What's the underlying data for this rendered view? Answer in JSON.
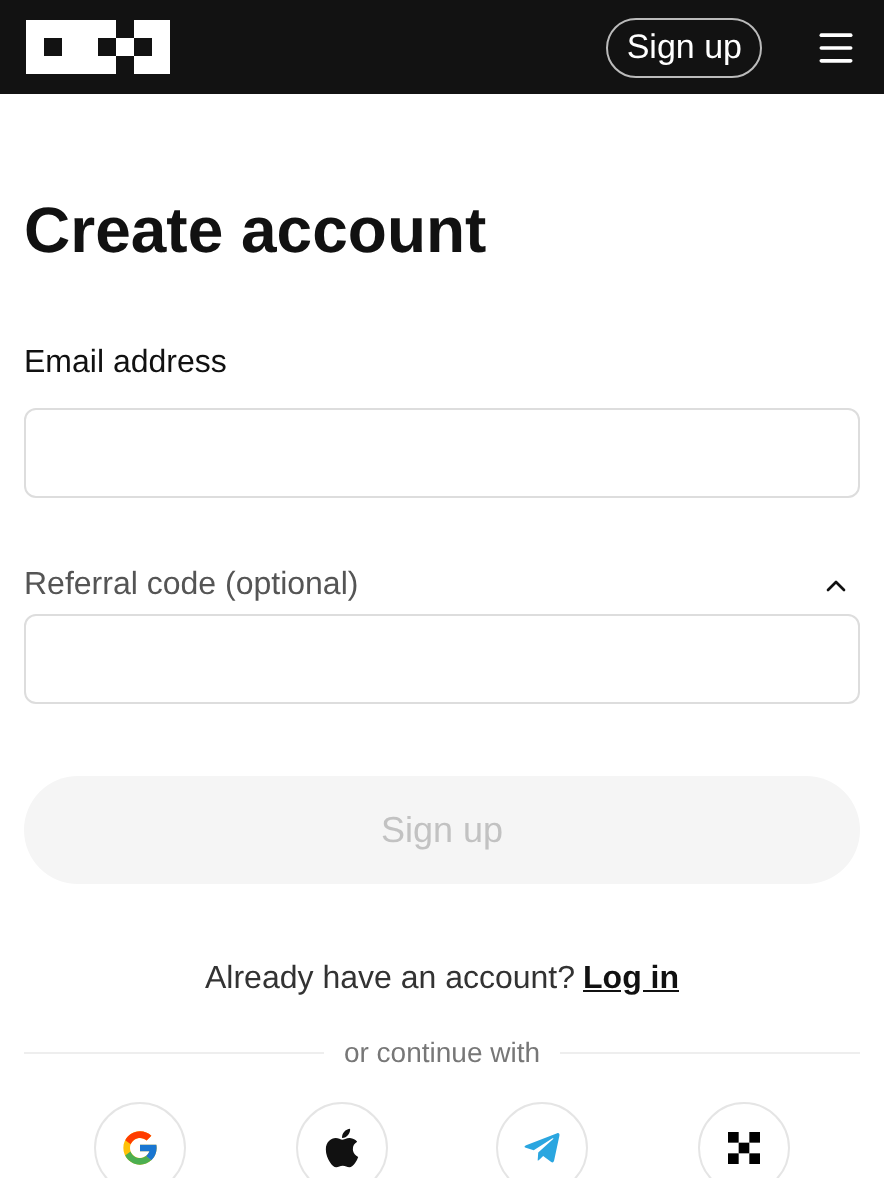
{
  "header": {
    "signup_button": "Sign up"
  },
  "title": "Create account",
  "email": {
    "label": "Email address"
  },
  "referral": {
    "label": "Referral code (optional)",
    "expanded": true
  },
  "submit": {
    "label": "Sign up",
    "disabled": true
  },
  "login_prompt": {
    "text": "Already have an account?",
    "link": "Log in"
  },
  "divider_text": "or continue with",
  "social": [
    {
      "kind": "google"
    },
    {
      "kind": "apple"
    },
    {
      "kind": "telegram"
    },
    {
      "kind": "grid"
    }
  ]
}
